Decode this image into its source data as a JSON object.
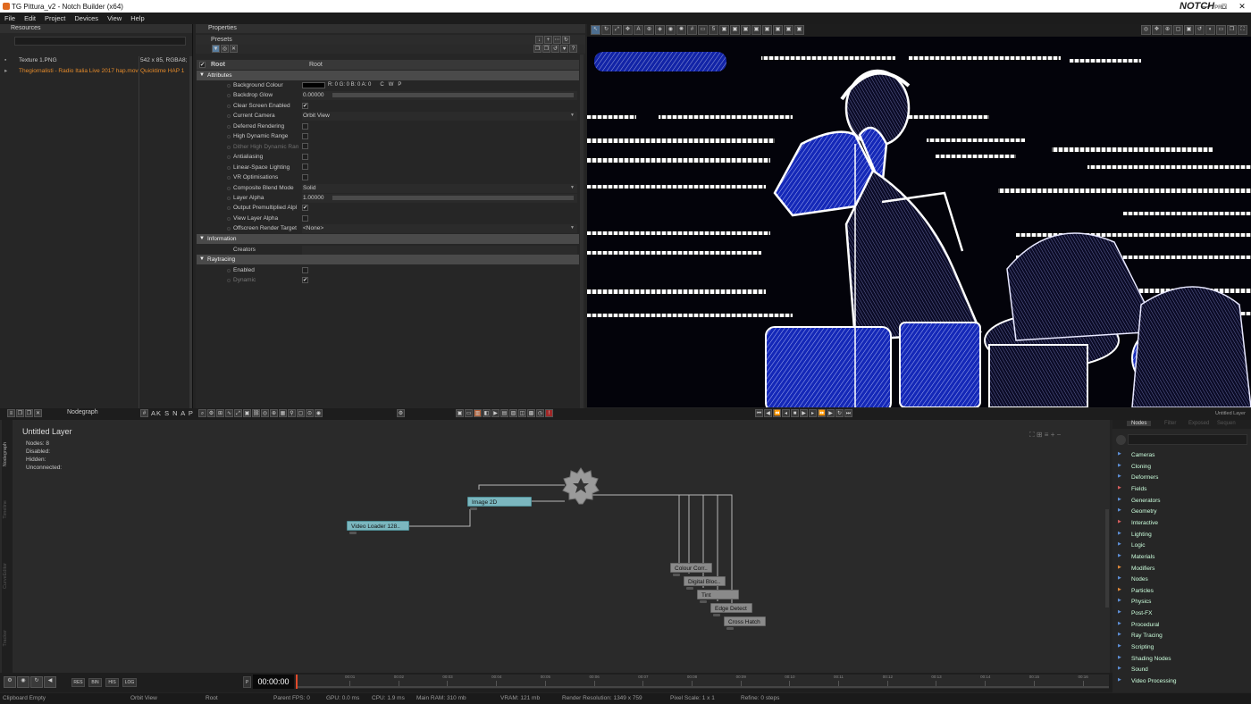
{
  "window": {
    "title": "TG Pittura_v2 - Notch Builder (x64)",
    "brand": "NOTCH",
    "brand_tier": "PRO",
    "min": "—",
    "max": "□",
    "close": "✕"
  },
  "menu": [
    "File",
    "Edit",
    "Project",
    "Devices",
    "View",
    "Help"
  ],
  "resources": {
    "title": "Resources",
    "rows": [
      {
        "name": "Texture 1.PNG",
        "info": "542 x 85, RGBA8;",
        "color": "#c8c8c8"
      },
      {
        "name": "Thegiornalisti - Radio Italia Live 2017 hap.mov",
        "info": "Quicktime HAP 1",
        "color": "#e48a2a"
      }
    ]
  },
  "properties": {
    "title": "Properties",
    "presets": "Presets",
    "root_label": "Root",
    "root_value": "Root",
    "sections": {
      "attributes": "Attributes",
      "information": "Information",
      "raytracing": "Raytracing"
    },
    "rows": [
      {
        "label": "Background Colour",
        "value": "R: 0 G: 0 B: 0 A: 0      C   W   P",
        "type": "color"
      },
      {
        "label": "Backdrop Glow",
        "value": "0.00000",
        "type": "slider"
      },
      {
        "label": "Clear Screen Enabled",
        "value": "✔",
        "type": "check"
      },
      {
        "label": "Current Camera",
        "value": "Orbit View",
        "type": "select"
      },
      {
        "label": "Deferred Rendering",
        "value": "",
        "type": "check"
      },
      {
        "label": "High Dynamic Range",
        "value": "",
        "type": "check"
      },
      {
        "label": "Dither High Dynamic Ran",
        "value": "",
        "type": "check",
        "dim": true
      },
      {
        "label": "Antialiasing",
        "value": "",
        "type": "check"
      },
      {
        "label": "Linear-Space Lighting",
        "value": "",
        "type": "check"
      },
      {
        "label": "VR Optimisations",
        "value": "",
        "type": "check"
      },
      {
        "label": "Composite Blend Mode",
        "value": "Solid",
        "type": "select"
      },
      {
        "label": "Layer Alpha",
        "value": "1.00000",
        "type": "slider"
      },
      {
        "label": "Output Premultiplied Alpl",
        "value": "✔",
        "type": "check"
      },
      {
        "label": "View Layer Alpha",
        "value": "",
        "type": "check"
      },
      {
        "label": "Offscreen Render Target",
        "value": "<None>",
        "type": "select"
      }
    ],
    "info_rows": [
      {
        "label": "Creators",
        "value": ""
      }
    ],
    "ray_rows": [
      {
        "label": "Enabled",
        "value": ""
      },
      {
        "label": "Dynamic",
        "value": "✔",
        "dim": true
      }
    ]
  },
  "nodegraph": {
    "tab": "Nodegraph",
    "snap": "AK S N A P",
    "layer_title": "Untitled  Layer",
    "stats": [
      "Nodes:  8",
      "Disabled:",
      "Hidden:",
      "Unconnected:"
    ],
    "side_tabs": [
      "Nodegraph",
      "Timeline",
      "CurveEditor",
      "Tracker"
    ],
    "nodes": [
      {
        "label": "Video  Loader  128..",
        "style": "teal"
      },
      {
        "label": "Image  2D",
        "style": "teal"
      },
      {
        "label": "Colour  Corr..",
        "style": "grey"
      },
      {
        "label": "Digital  Bloc..",
        "style": "grey"
      },
      {
        "label": "Tint",
        "style": "grey"
      },
      {
        "label": "Edge  Detect",
        "style": "grey"
      },
      {
        "label": "Cross  Hatch",
        "style": "grey"
      }
    ]
  },
  "nodepanel": {
    "tabs": [
      "Nodes",
      "Filter",
      "Exposed",
      "Sequen"
    ],
    "layer": "Untitled Layer",
    "items": [
      "Cameras",
      "Cloning",
      "Deformers",
      "Fields",
      "Generators",
      "Geometry",
      "Interactive",
      "Lighting",
      "Logic",
      "Materials",
      "Modifiers",
      "Nodes",
      "Particles",
      "Physics",
      "Post-FX",
      "Procedural",
      "Ray Tracing",
      "Scripting",
      "Shading Nodes",
      "Sound",
      "Video Processing"
    ]
  },
  "timeline": {
    "timecode": "00:00:00",
    "buttons": [
      "RES",
      "BIN",
      "HIS",
      "LOG"
    ],
    "ticks": [
      "00:01",
      "00:02",
      "00:03",
      "00:04",
      "00:05",
      "00:06",
      "00:07",
      "00:08",
      "00:09",
      "00:10",
      "00:11",
      "00:12",
      "00:13",
      "00:14",
      "00:15",
      "00:16"
    ]
  },
  "status": [
    "Clipboard Empty",
    "Orbit View",
    "Root",
    "Parent  FPS: 0",
    "GPU: 0.0 ms",
    "CPU: 1.9 ms",
    "Main RAM: 310 mb",
    "VRAM: 121 mb",
    "Render Resolution: 1349 x 759",
    "Pixel Scale: 1 x 1",
    "Refine: 0 steps"
  ],
  "colors": {
    "accent": "#e48a2a",
    "node_teal": "#7bb7bf",
    "viewport_blue": "#2a3fd0"
  }
}
